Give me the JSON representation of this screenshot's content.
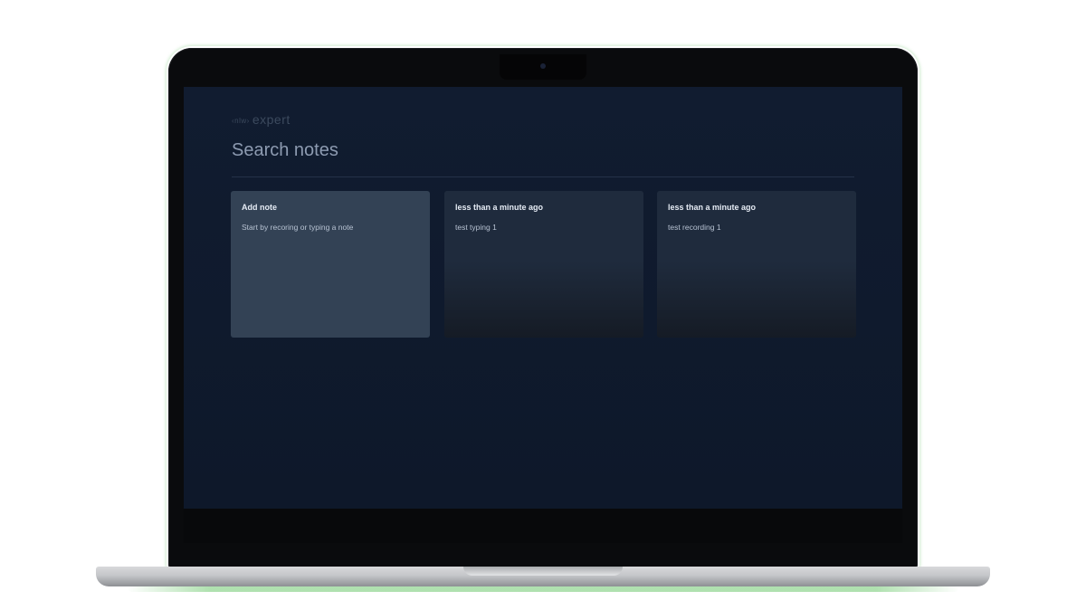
{
  "app": {
    "brand_prefix": "‹nlw›",
    "brand_name": "expert",
    "title": "Search notes"
  },
  "cards": [
    {
      "heading": "Add note",
      "text": "Start by recoring or typing a note"
    },
    {
      "heading": "less than a minute ago",
      "text": "test typing 1"
    },
    {
      "heading": "less than a minute ago",
      "text": "test recording 1"
    }
  ],
  "colors": {
    "screen_bg": "#111c30",
    "add_card_bg": "#334255",
    "note_card_bg": "#1f2b3d"
  }
}
